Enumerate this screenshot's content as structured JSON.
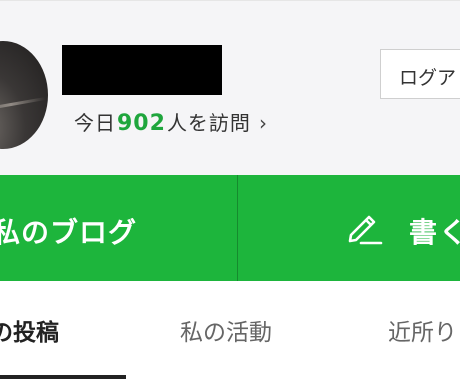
{
  "profile": {
    "visits_prefix": "今日",
    "visits_count": "902",
    "visits_suffix": "人を訪問",
    "visits_chevron": "›",
    "logout_label": "ログア"
  },
  "actions": {
    "blog_label": "私のブログ",
    "write_label": "書く"
  },
  "tabs": [
    {
      "label": "の投稿",
      "active": true
    },
    {
      "label": "私の活動",
      "active": false
    },
    {
      "label": "近所り",
      "active": false
    }
  ],
  "colors": {
    "brand_green": "#1db53c",
    "count_green": "#1fa63d"
  },
  "icons": {
    "write": "pencil-icon"
  }
}
